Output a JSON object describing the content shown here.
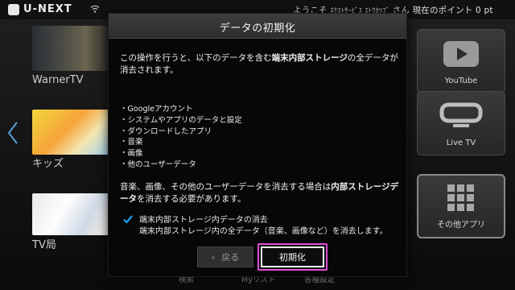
{
  "app": {
    "logo_text": "U-NEXT",
    "welcome_prefix": "ようこそ",
    "username": "ﾈｸｽﾄｻｰﾋﾞｽ ｽﾄｳｶﾂﾌﾞ",
    "welcome_suffix": "さん",
    "points_label": "現在のポイント",
    "points_value": "0",
    "points_unit": "pt"
  },
  "rows": [
    {
      "label": "WarnerTV"
    },
    {
      "label": "キッズ"
    },
    {
      "label": "TV局"
    }
  ],
  "tiles": [
    {
      "label": "YouTube",
      "icon": "youtube-play-icon"
    },
    {
      "label": "Live TV",
      "icon": "tv-icon"
    },
    {
      "label": "その他アプリ",
      "icon": "grid-icon"
    }
  ],
  "bottom_hints": [
    "検索",
    "Myリスト",
    "各種設定"
  ],
  "dialog": {
    "title": "データの初期化",
    "intro_a": "この操作を行うと、以下のデータを含む",
    "intro_bold": "端末内部ストレージ",
    "intro_b": "の全データが消去されます。",
    "bullets": [
      "・Googleアカウント",
      "・システムやアプリのデータと設定",
      "・ダウンロードしたアプリ",
      "・音楽",
      "・画像",
      "・他のユーザーデータ"
    ],
    "note_a": "音楽、画像、その他のユーザーデータを消去する場合は",
    "note_bold": "内部ストレージデータ",
    "note_b": "を消去する必要があります。",
    "checkbox": {
      "checked": true,
      "title": "端末内部ストレージ内データの消去",
      "description": "端末内部ストレージ内の全データ（音楽、画像など）を消去します。"
    },
    "back_label": "戻る",
    "confirm_label": "初期化",
    "accent_color": "#e04fd7"
  }
}
